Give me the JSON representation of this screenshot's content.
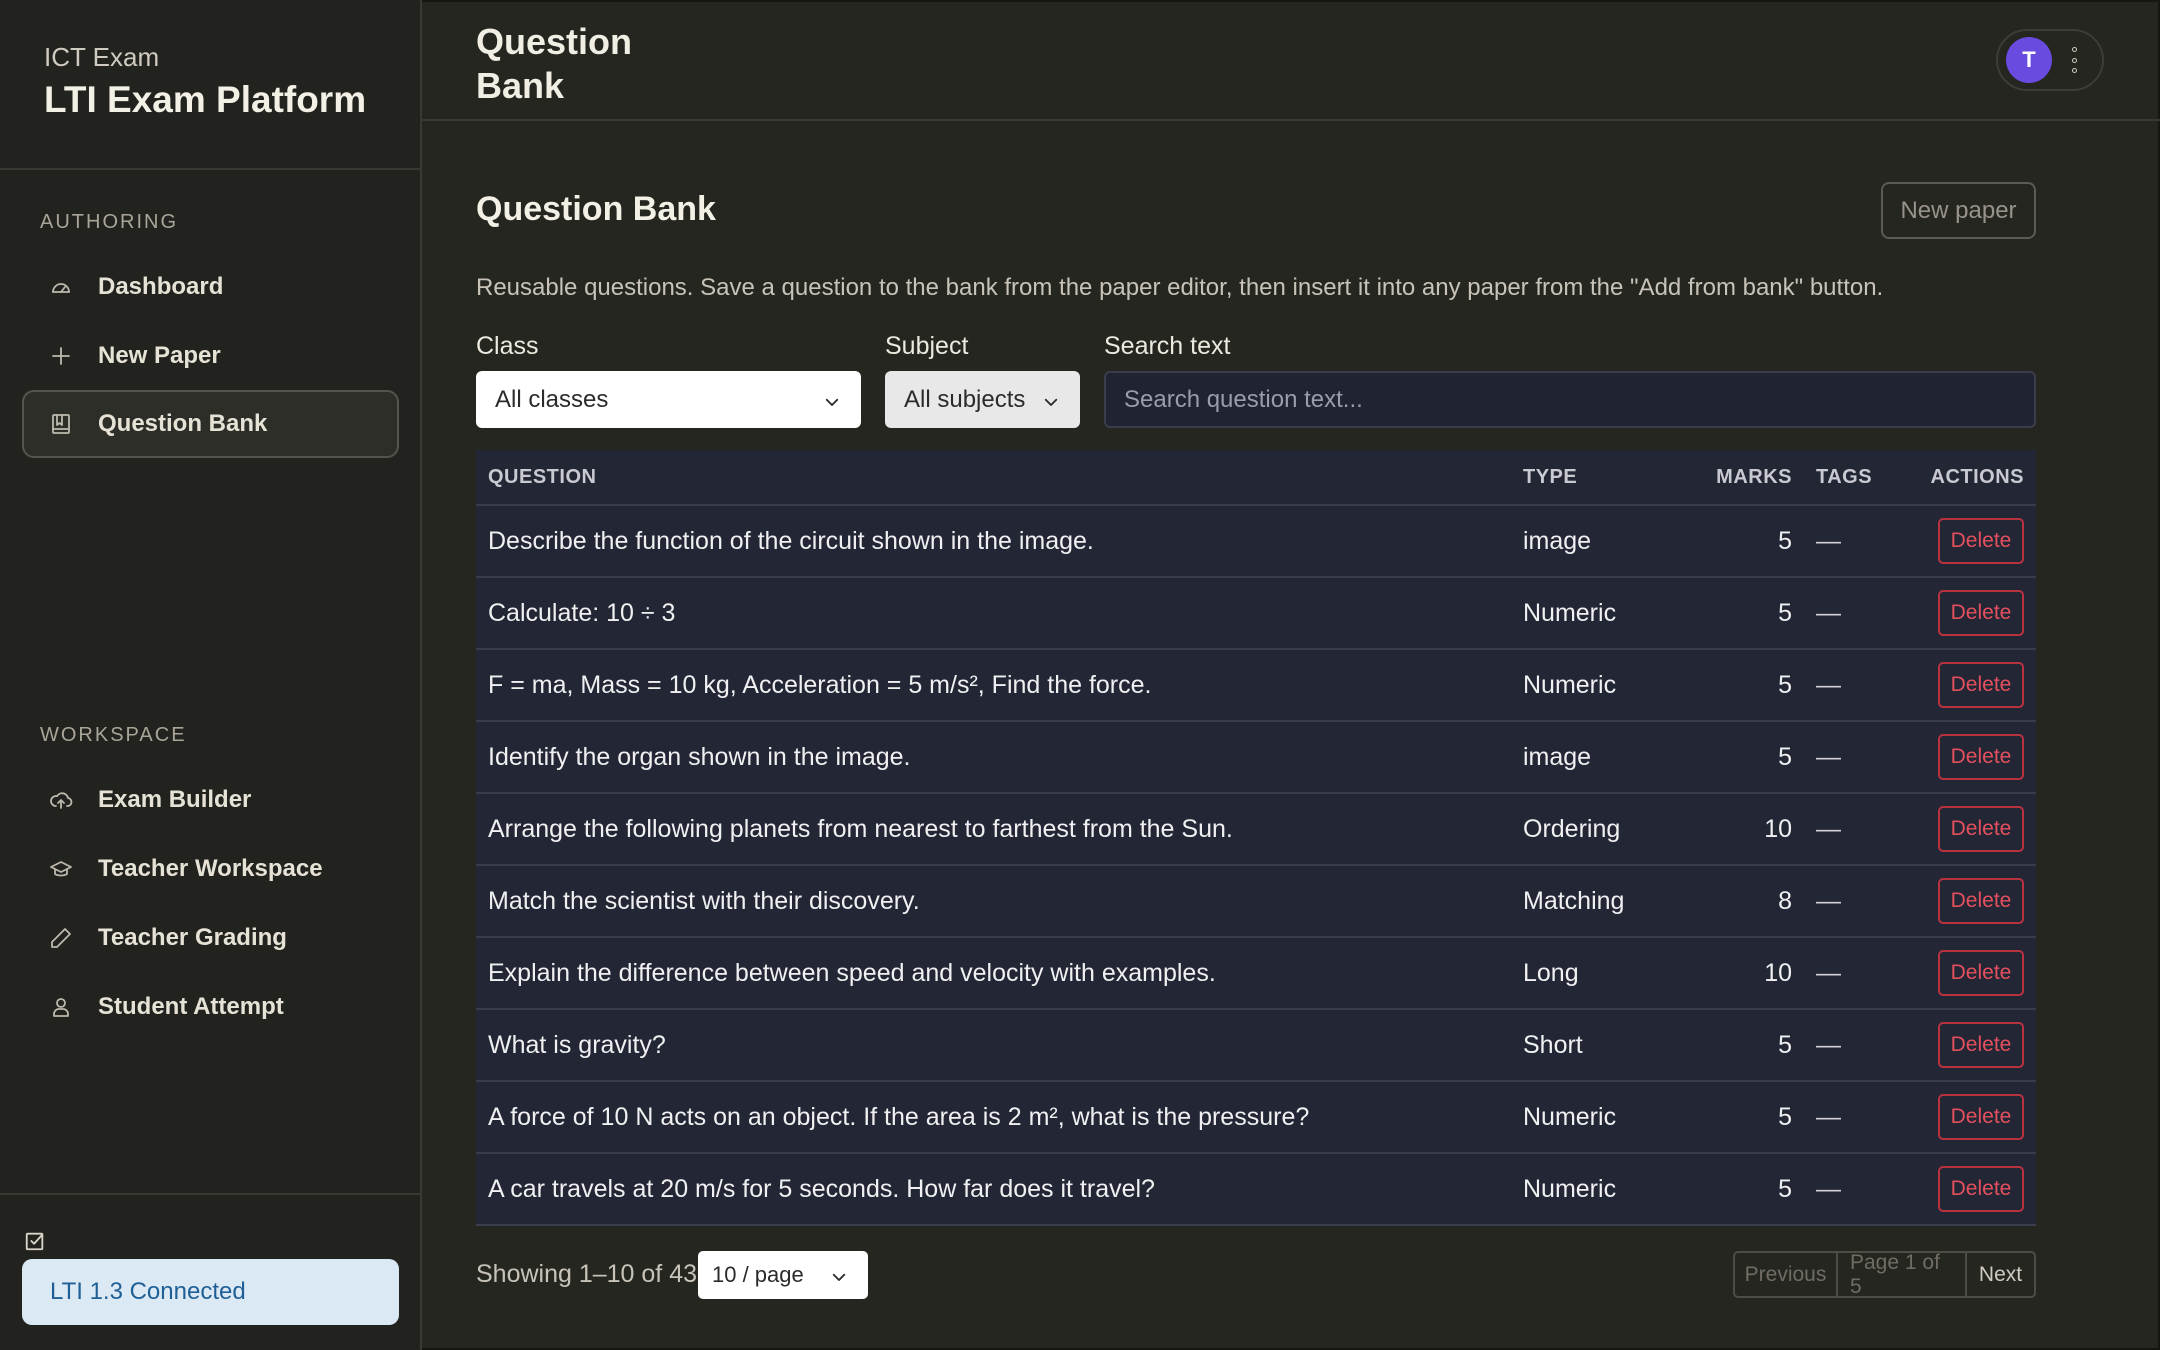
{
  "brand": {
    "subtitle": "ICT Exam",
    "title": "LTI Exam Platform"
  },
  "sidebar": {
    "sections": [
      {
        "label": "AUTHORING",
        "items": [
          {
            "label": "Dashboard",
            "icon": "gauge-icon",
            "active": false
          },
          {
            "label": "New Paper",
            "icon": "plus-icon",
            "active": false
          },
          {
            "label": "Question Bank",
            "icon": "book-icon",
            "active": true
          }
        ]
      },
      {
        "label": "WORKSPACE",
        "items": [
          {
            "label": "Exam Builder",
            "icon": "cloud-upload-icon",
            "active": false
          },
          {
            "label": "Teacher Workspace",
            "icon": "graduation-cap-icon",
            "active": false
          },
          {
            "label": "Teacher Grading",
            "icon": "pencil-icon",
            "active": false
          },
          {
            "label": "Student Attempt",
            "icon": "user-icon",
            "active": false
          }
        ]
      }
    ],
    "status": {
      "icon": "checkbox-icon",
      "label": "LTI 1.3 Connected"
    }
  },
  "header": {
    "title": "Question Bank",
    "avatar_initial": "T",
    "avatar_color": "#6a4be0"
  },
  "main": {
    "heading": "Question Bank",
    "new_paper_label": "New paper",
    "description": "Reusable questions. Save a question to the bank from the paper editor, then insert it into any paper from the \"Add from bank\" button.",
    "filters": {
      "class_label": "Class",
      "class_value": "All classes",
      "subject_label": "Subject",
      "subject_value": "All subjects",
      "search_label": "Search text",
      "search_placeholder": "Search question text..."
    },
    "table": {
      "headers": {
        "question": "QUESTION",
        "type": "TYPE",
        "marks": "MARKS",
        "tags": "TAGS",
        "actions": "ACTIONS"
      },
      "rows": [
        {
          "question": "Describe the function of the circuit shown in the image.",
          "type": "image",
          "marks": "5",
          "tags": "—",
          "action": "Delete"
        },
        {
          "question": "Calculate: 10 ÷ 3",
          "type": "Numeric",
          "marks": "5",
          "tags": "—",
          "action": "Delete"
        },
        {
          "question": "F = ma, Mass = 10 kg, Acceleration = 5 m/s², Find the force.",
          "type": "Numeric",
          "marks": "5",
          "tags": "—",
          "action": "Delete"
        },
        {
          "question": "Identify the organ shown in the image.",
          "type": "image",
          "marks": "5",
          "tags": "—",
          "action": "Delete"
        },
        {
          "question": "Arrange the following planets from nearest to farthest from the Sun.",
          "type": "Ordering",
          "marks": "10",
          "tags": "—",
          "action": "Delete"
        },
        {
          "question": "Match the scientist with their discovery.",
          "type": "Matching",
          "marks": "8",
          "tags": "—",
          "action": "Delete"
        },
        {
          "question": "Explain the difference between speed and velocity with examples.",
          "type": "Long",
          "marks": "10",
          "tags": "—",
          "action": "Delete"
        },
        {
          "question": "What is gravity?",
          "type": "Short",
          "marks": "5",
          "tags": "—",
          "action": "Delete"
        },
        {
          "question": "A force of 10 N acts on an object. If the area is 2 m², what is the pressure?",
          "type": "Numeric",
          "marks": "5",
          "tags": "—",
          "action": "Delete"
        },
        {
          "question": "A car travels at 20 m/s for 5 seconds. How far does it travel?",
          "type": "Numeric",
          "marks": "5",
          "tags": "—",
          "action": "Delete"
        }
      ]
    },
    "footer": {
      "showing": "Showing 1–10 of 43",
      "per_page": "10 / page",
      "previous": "Previous",
      "page_info": "Page 1 of 5",
      "next": "Next"
    }
  }
}
